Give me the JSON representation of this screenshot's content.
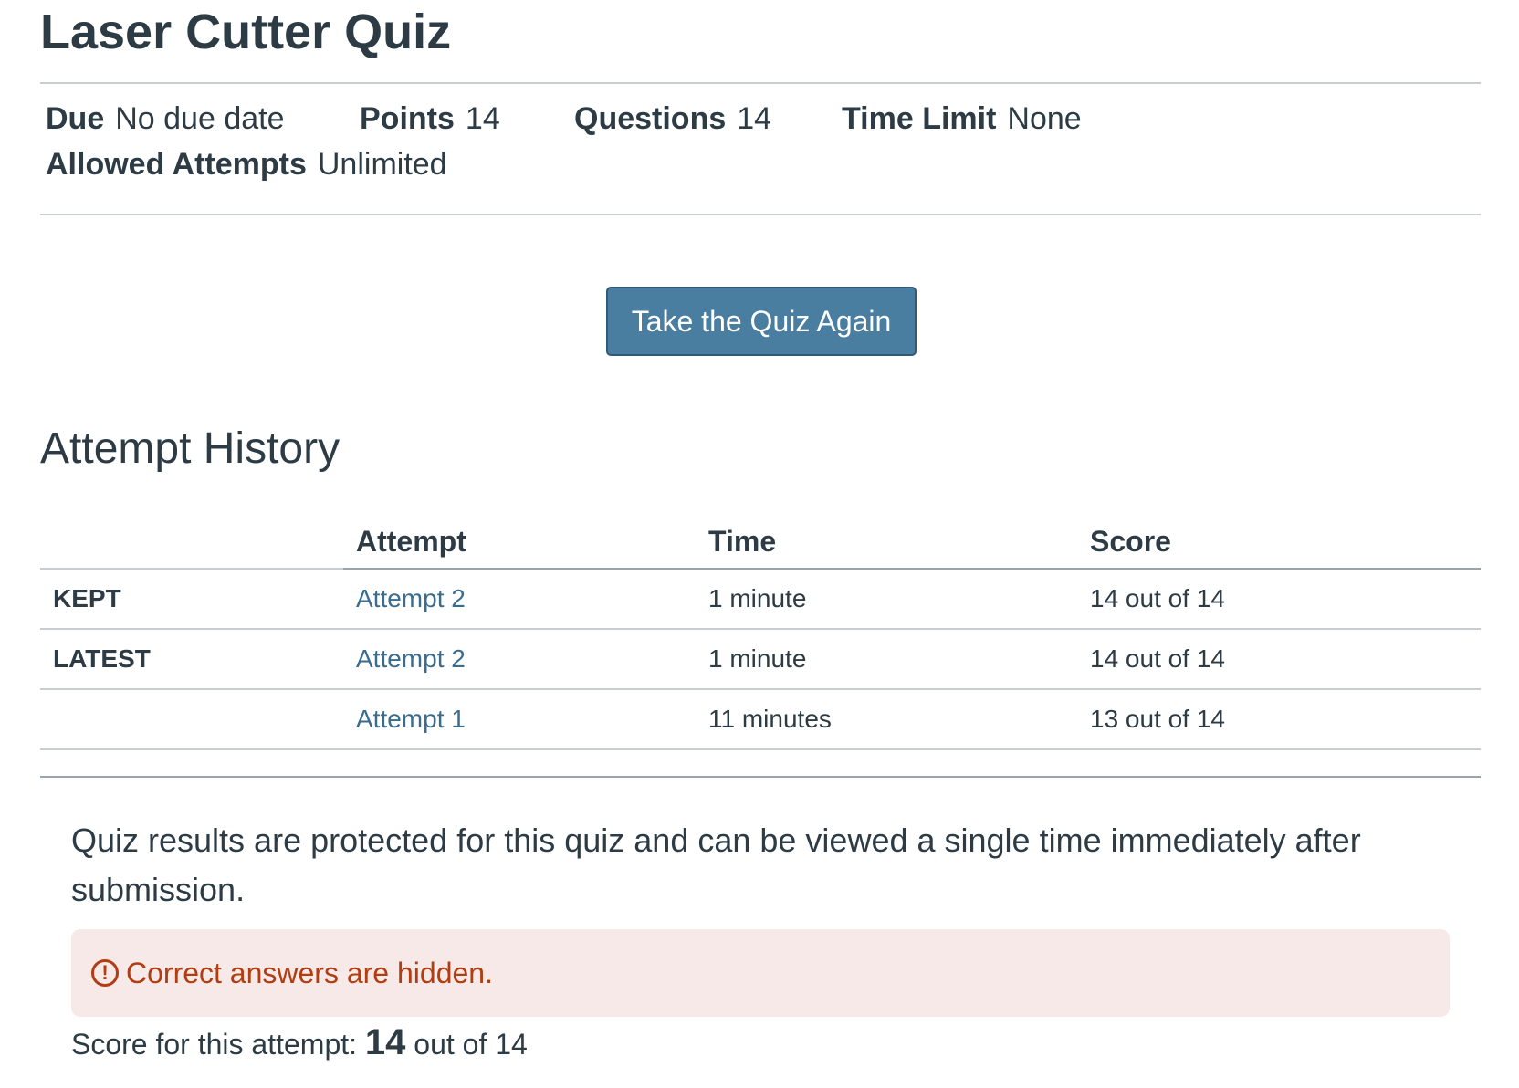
{
  "quiz": {
    "title": "Laser Cutter Quiz"
  },
  "meta": {
    "due_label": "Due",
    "due_value": "No due date",
    "points_label": "Points",
    "points_value": "14",
    "questions_label": "Questions",
    "questions_value": "14",
    "time_limit_label": "Time Limit",
    "time_limit_value": "None",
    "attempts_label": "Allowed Attempts",
    "attempts_value": "Unlimited"
  },
  "actions": {
    "take_again_label": "Take the Quiz Again"
  },
  "history": {
    "title": "Attempt History",
    "columns": [
      "",
      "Attempt",
      "Time",
      "Score"
    ],
    "rows": [
      {
        "tag": "KEPT",
        "attempt": "Attempt 2",
        "time": "1 minute",
        "score": "14 out of 14"
      },
      {
        "tag": "LATEST",
        "attempt": "Attempt 2",
        "time": "1 minute",
        "score": "14 out of 14"
      },
      {
        "tag": "",
        "attempt": "Attempt 1",
        "time": "11 minutes",
        "score": "13 out of 14"
      }
    ]
  },
  "results": {
    "protected_message": "Quiz results are protected for this quiz and can be viewed a single time immediately after submission.",
    "alert_text": "Correct answers are hidden.",
    "alert_icon": "warning-circle-icon",
    "score_prefix": "Score for this attempt:",
    "score_value": "14",
    "score_suffix": "out of 14"
  },
  "colors": {
    "button_bg": "#4a7ea1",
    "link": "#3a6c8e",
    "alert_bg": "#f6e9e8",
    "alert_text": "#b23d12",
    "text": "#2d3b45"
  }
}
